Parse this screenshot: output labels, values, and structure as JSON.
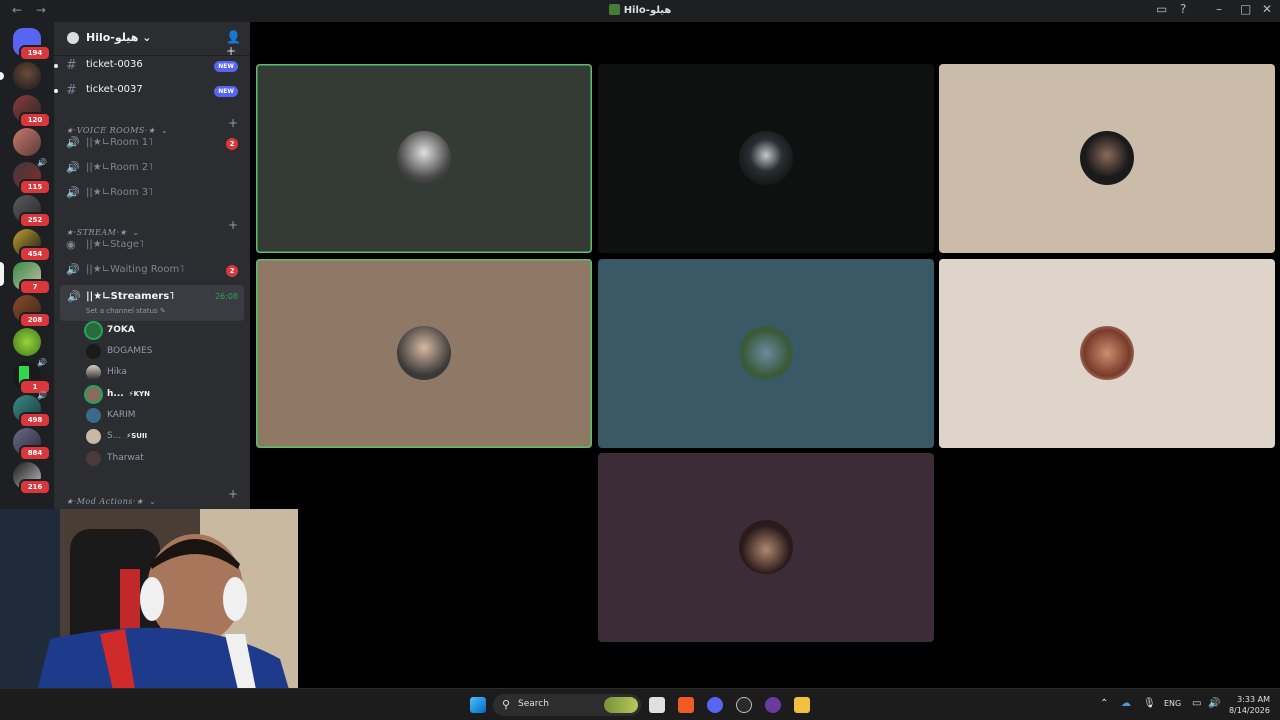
{
  "window": {
    "title": "Hilo-هيلو",
    "back_glyph": "←",
    "forward_glyph": "→"
  },
  "rail": {
    "servers": [
      {
        "badge": "194"
      },
      {
        "badge": ""
      },
      {
        "badge": "120"
      },
      {
        "badge": ""
      },
      {
        "badge": "115"
      },
      {
        "badge": "252"
      },
      {
        "badge": "454"
      },
      {
        "badge": "7"
      },
      {
        "badge": "208"
      },
      {
        "badge": ""
      },
      {
        "badge": "1"
      },
      {
        "badge": "498"
      },
      {
        "badge": "884"
      },
      {
        "badge": "216"
      }
    ]
  },
  "guild": {
    "name": "Hilo-هيلو",
    "text_channels": [
      {
        "label": "ticket-0036",
        "badge": "NEW"
      },
      {
        "label": "ticket-0037",
        "badge": "NEW"
      }
    ],
    "categories": {
      "voice_rooms": "★·VOICE ROOMS·★",
      "stream": "★·STREAM·★",
      "mod_actions": "★·Mod Actions·★"
    },
    "voice_rooms": [
      {
        "label": "||★∟Room 1˥",
        "count": "2"
      },
      {
        "label": "||★∟Room 2˥",
        "count": ""
      },
      {
        "label": "||★∟Room 3˥",
        "count": ""
      }
    ],
    "stream_channels": {
      "stage": "||★∟Stage˥",
      "waiting": "||★∟Waiting Room˥",
      "waiting_count": "2",
      "streamers": "||★∟Streamers˥",
      "streamers_time": "26:08",
      "streamers_status": "Set a channel status"
    },
    "voice_users": [
      {
        "name": "7OKA",
        "tag": "",
        "bright": true
      },
      {
        "name": "BOGAMES",
        "tag": "",
        "bright": false
      },
      {
        "name": "Hika",
        "tag": "",
        "bright": false
      },
      {
        "name": "h...",
        "tag": "⚡KYN",
        "bright": true
      },
      {
        "name": "KARIM",
        "tag": "",
        "bright": false
      },
      {
        "name": "S...",
        "tag": "⚡SUII",
        "bright": false
      },
      {
        "name": "Tharwat",
        "tag": "",
        "bright": false
      }
    ]
  },
  "taskbar": {
    "search_placeholder": "Search",
    "language": "ENG",
    "time": "3:33 AM",
    "date": "8/14/2026"
  },
  "colors": {
    "accent_green": "#23a559",
    "badge_red": "#da373c",
    "blurple": "#5865f2"
  }
}
